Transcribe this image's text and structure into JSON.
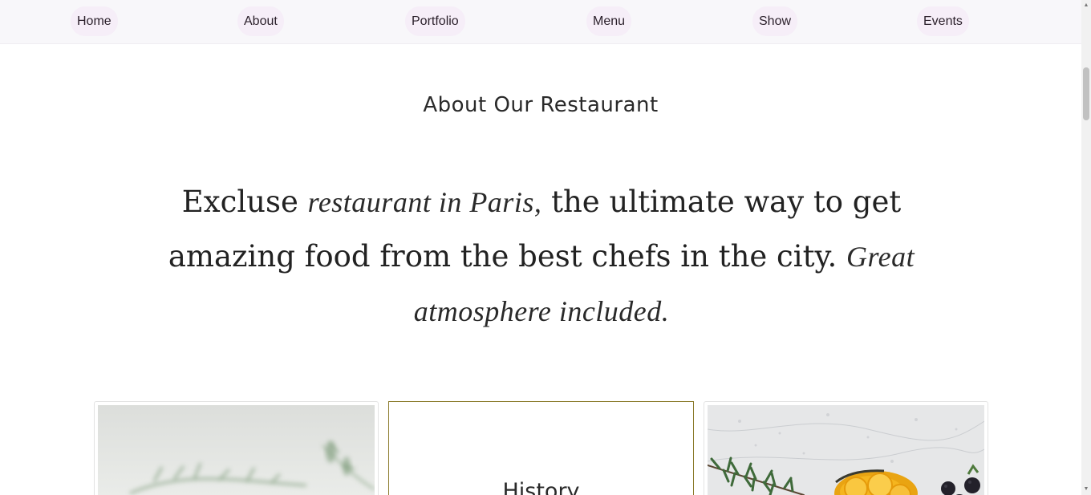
{
  "nav": {
    "items": [
      {
        "label": "Home"
      },
      {
        "label": "About"
      },
      {
        "label": "Portfolio"
      },
      {
        "label": "Menu"
      },
      {
        "label": "Show"
      },
      {
        "label": "Events"
      }
    ]
  },
  "about": {
    "title": "About Our Restaurant",
    "intro": {
      "part1": "Excluse",
      "script1": "restaurant in Paris,",
      "part2": "the ultimate way to get amazing food from the best chefs in the city.",
      "script2": "Great atmosphere included."
    }
  },
  "cards": {
    "history_title": "History"
  },
  "colors": {
    "nav_background": "#f8f7fa",
    "nav_pill": "#f6eef8",
    "history_border": "#8a7a2a"
  }
}
